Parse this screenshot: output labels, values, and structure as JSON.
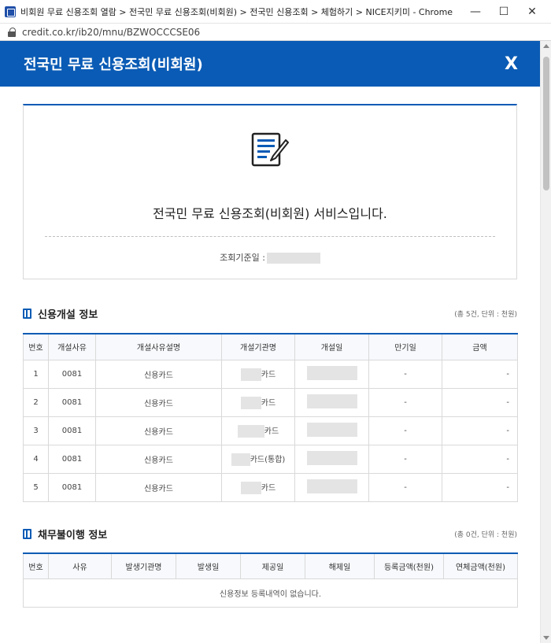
{
  "window": {
    "title": "비회원 무료 신용조회 열람 > 전국민 무료 신용조회(비회원) > 전국민 신용조회 > 체험하기 > NICE지키미 - Chrome",
    "minimize": "—",
    "maximize": "☐",
    "close": "✕"
  },
  "address": {
    "url": "credit.co.kr/ib20/mnu/BZWOCCCSE06"
  },
  "header": {
    "title": "전국민 무료 신용조회(비회원)",
    "close": "X"
  },
  "intro": {
    "message": "전국민 무료 신용조회(비회원) 서비스입니다.",
    "date_label": "조회기준일 :"
  },
  "open_info": {
    "title": "신용개설 정보",
    "note": "(총 5건, 단위 : 천원)",
    "columns": [
      "번호",
      "개설사유",
      "개설사유설명",
      "개설기관명",
      "개설일",
      "만기일",
      "금액"
    ],
    "rows": [
      {
        "no": "1",
        "code": "0081",
        "desc": "신용카드",
        "org": "카드",
        "expire": "-",
        "amount": "-"
      },
      {
        "no": "2",
        "code": "0081",
        "desc": "신용카드",
        "org": "카드",
        "expire": "-",
        "amount": "-"
      },
      {
        "no": "3",
        "code": "0081",
        "desc": "신용카드",
        "org": "카드",
        "expire": "-",
        "amount": "-"
      },
      {
        "no": "4",
        "code": "0081",
        "desc": "신용카드",
        "org": "카드(통합)",
        "expire": "-",
        "amount": "-"
      },
      {
        "no": "5",
        "code": "0081",
        "desc": "신용카드",
        "org": "카드",
        "expire": "-",
        "amount": "-"
      }
    ]
  },
  "default_info": {
    "title": "채무불이행 정보",
    "note": "(총 0건, 단위 : 천원)",
    "columns": [
      "번호",
      "사유",
      "발생기관명",
      "발생일",
      "제공일",
      "해제일",
      "등록금액(천원)",
      "연체금액(천원)"
    ],
    "empty": "신용정보 등록내역이 없습니다."
  }
}
